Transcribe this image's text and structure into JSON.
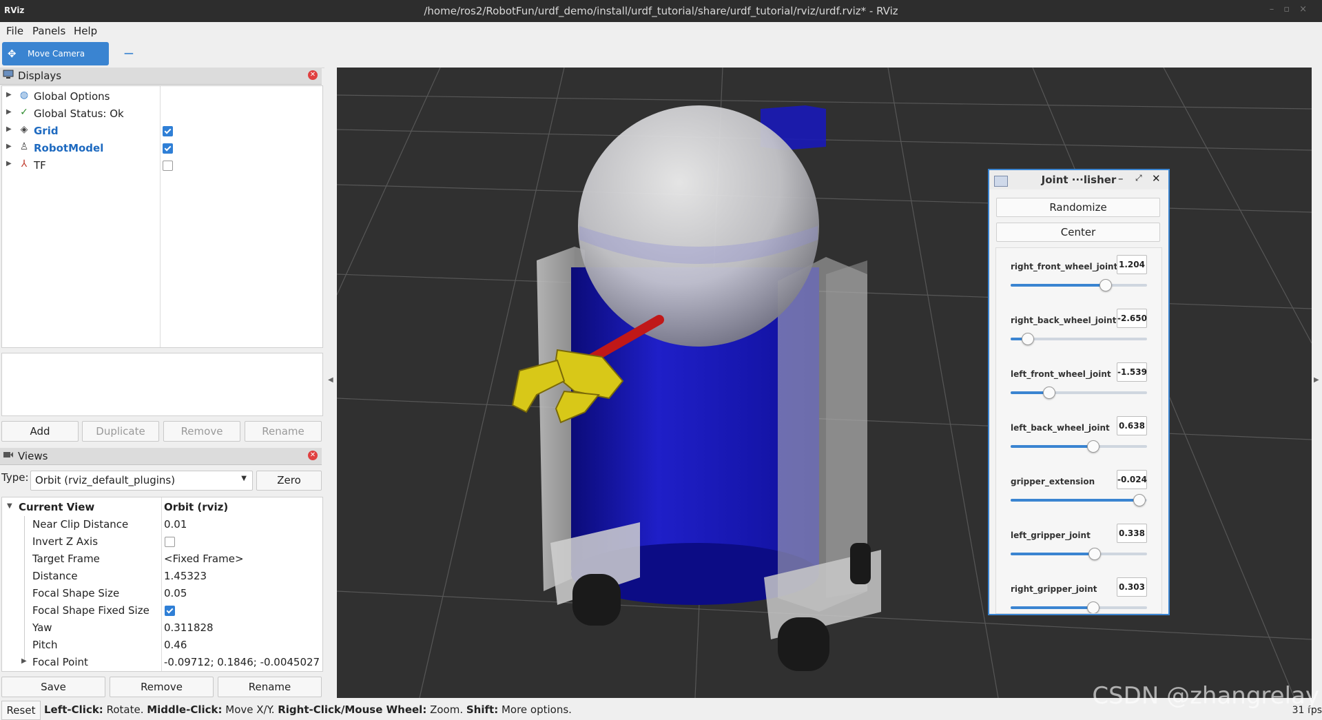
{
  "window": {
    "app_icon_text": "RViz",
    "title": "/home/ros2/RobotFun/urdf_demo/install/urdf_tutorial/share/urdf_tutorial/rviz/urdf.rviz* - RViz"
  },
  "menu": {
    "file": "File",
    "panels": "Panels",
    "help": "Help"
  },
  "toolbar": {
    "move_camera": "Move Camera"
  },
  "displays": {
    "title": "Displays",
    "items": [
      {
        "label": "Global Options",
        "icon": "globe-icon",
        "checkbox": null
      },
      {
        "label": "Global Status: Ok",
        "icon": "check-icon",
        "checkbox": null
      },
      {
        "label": "Grid",
        "icon": "grid-icon",
        "checkbox": true
      },
      {
        "label": "RobotModel",
        "icon": "robot-icon",
        "checkbox": true
      },
      {
        "label": "TF",
        "icon": "tf-axes-icon",
        "checkbox": false
      }
    ],
    "buttons": {
      "add": "Add",
      "duplicate": "Duplicate",
      "remove": "Remove",
      "rename": "Rename"
    }
  },
  "views": {
    "title": "Views",
    "type_label": "Type:",
    "type_value": "Orbit (rviz_default_plugins)",
    "zero": "Zero",
    "current_view": {
      "label": "Current View",
      "value": "Orbit (rviz)"
    },
    "properties": [
      {
        "name": "Near Clip Distance",
        "value": "0.01"
      },
      {
        "name": "Invert Z Axis",
        "value": "",
        "checkbox": false
      },
      {
        "name": "Target Frame",
        "value": "<Fixed Frame>"
      },
      {
        "name": "Distance",
        "value": "1.45323"
      },
      {
        "name": "Focal Shape Size",
        "value": "0.05"
      },
      {
        "name": "Focal Shape Fixed Size",
        "value": "",
        "checkbox": true
      },
      {
        "name": "Yaw",
        "value": "0.311828"
      },
      {
        "name": "Pitch",
        "value": "0.46"
      },
      {
        "name": "Focal Point",
        "value": "-0.09712; 0.1846; -0.0045027"
      }
    ],
    "buttons": {
      "save": "Save",
      "remove": "Remove",
      "rename": "Rename"
    }
  },
  "status": {
    "reset": "Reset",
    "hint": [
      {
        "key": "Left-Click:",
        "text": " Rotate. "
      },
      {
        "key": "Middle-Click:",
        "text": " Move X/Y. "
      },
      {
        "key": "Right-Click/Mouse Wheel:",
        "text": " Zoom. "
      },
      {
        "key": "Shift:",
        "text": " More options."
      }
    ],
    "fps": "31 fps"
  },
  "joint_publisher": {
    "title": "Joint ···lisher",
    "randomize": "Randomize",
    "center": "Center",
    "joints": [
      {
        "name": "right_front_wheel_joint",
        "value": "1.204",
        "fraction": 0.69
      },
      {
        "name": "right_back_wheel_joint",
        "value": "-2.650",
        "fraction": 0.12
      },
      {
        "name": "left_front_wheel_joint",
        "value": "-1.539",
        "fraction": 0.28
      },
      {
        "name": "left_back_wheel_joint",
        "value": "0.638",
        "fraction": 0.6
      },
      {
        "name": "gripper_extension",
        "value": "-0.024",
        "fraction": 0.94
      },
      {
        "name": "left_gripper_joint",
        "value": "0.338",
        "fraction": 0.61
      },
      {
        "name": "right_gripper_joint",
        "value": "0.303",
        "fraction": 0.6
      }
    ]
  },
  "watermark": "CSDN @zhangrelay",
  "colors": {
    "accent": "#3a84d1",
    "viewport_bg": "#303030",
    "robot_body": "#1a1ab0",
    "gripper": "#e0d020"
  }
}
